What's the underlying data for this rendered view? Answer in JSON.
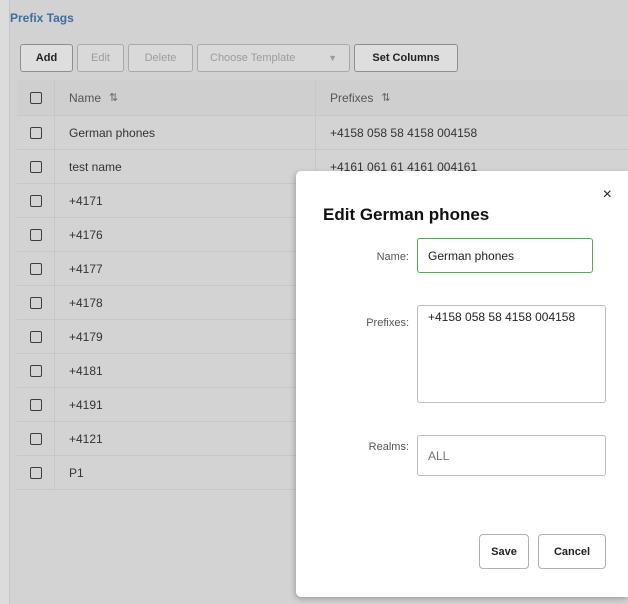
{
  "panel": {
    "title": "Prefix Tags"
  },
  "toolbar": {
    "add": "Add",
    "edit": "Edit",
    "delete": "Delete",
    "choose_template": "Choose Template",
    "set_columns": "Set Columns"
  },
  "grid": {
    "columns": {
      "name": "Name",
      "prefixes": "Prefixes"
    },
    "rows": [
      {
        "name": "German phones",
        "prefixes": "+4158 058 58 4158 004158"
      },
      {
        "name": "test name",
        "prefixes": "+4161 061 61 4161 004161"
      },
      {
        "name": "+4171",
        "prefixes": ""
      },
      {
        "name": "+4176",
        "prefixes": ""
      },
      {
        "name": "+4177",
        "prefixes": ""
      },
      {
        "name": "+4178",
        "prefixes": ""
      },
      {
        "name": "+4179",
        "prefixes": ""
      },
      {
        "name": "+4181",
        "prefixes": ""
      },
      {
        "name": "+4191",
        "prefixes": ""
      },
      {
        "name": "+4121",
        "prefixes": ""
      },
      {
        "name": "P1",
        "prefixes": ""
      }
    ]
  },
  "dialog": {
    "title": "Edit German phones",
    "close": "×",
    "name_label": "Name:",
    "name_value": "German phones",
    "prefixes_label": "Prefixes:",
    "prefixes_value": "+4158 058 58 4158 004158",
    "realms_label": "Realms:",
    "realms_placeholder": "ALL",
    "save": "Save",
    "cancel": "Cancel"
  },
  "icons": {
    "sort": "⇅",
    "dropdown": "▼"
  },
  "colors": {
    "title_blue": "#3a6f9f",
    "focus_green": "#4caf50"
  }
}
